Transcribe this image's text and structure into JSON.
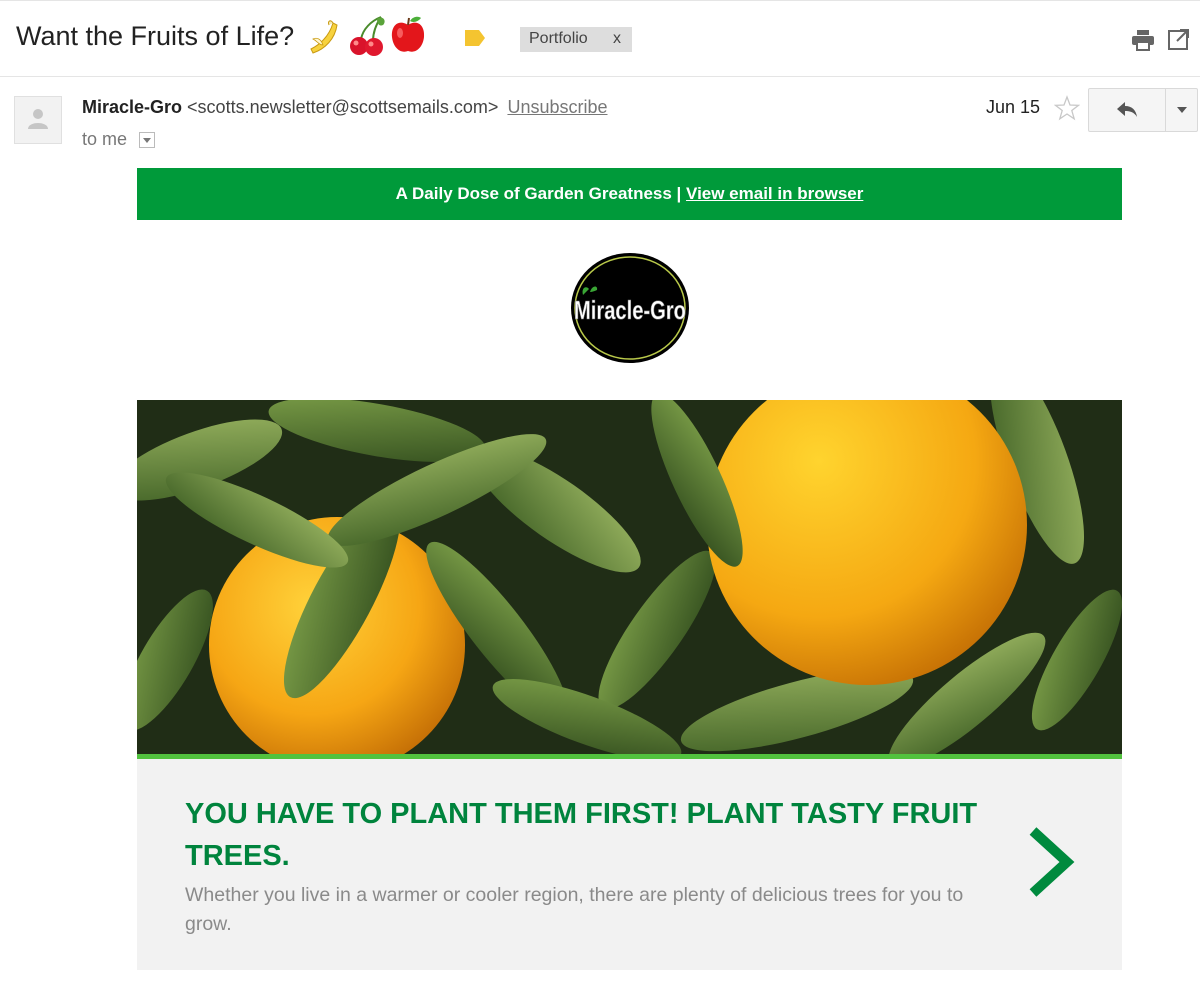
{
  "subject": {
    "title": "Want the Fruits of Life?",
    "emojis": [
      "banana-emoji",
      "cherries-emoji",
      "apple-emoji"
    ],
    "label_color": "#f4c430",
    "label_chip": {
      "text": "Portfolio",
      "remove": "x"
    },
    "toolbar_icons": [
      "print-icon",
      "popout-icon"
    ]
  },
  "message": {
    "sender_name": "Miracle-Gro",
    "sender_email": "<scotts.newsletter@scottsemails.com>",
    "unsubscribe": "Unsubscribe",
    "to": "to me",
    "date": "Jun 15",
    "actions": [
      "reply",
      "more"
    ]
  },
  "email": {
    "banner_text": "A Daily Dose of Garden Greatness | ",
    "banner_link": "View email in browser",
    "logo_text": "Miracle-Gro",
    "cta_title": "YOU HAVE TO PLANT THEM FIRST! PLANT TASTY FRUIT TREES.",
    "cta_body": "Whether you live in a warmer or cooler region, there are plenty of delicious trees for you to grow.",
    "colors": {
      "brand_green": "#009a3a",
      "headline_green": "#00843d",
      "accent_green": "#52c23e",
      "panel_grey": "#f2f2f2"
    }
  }
}
